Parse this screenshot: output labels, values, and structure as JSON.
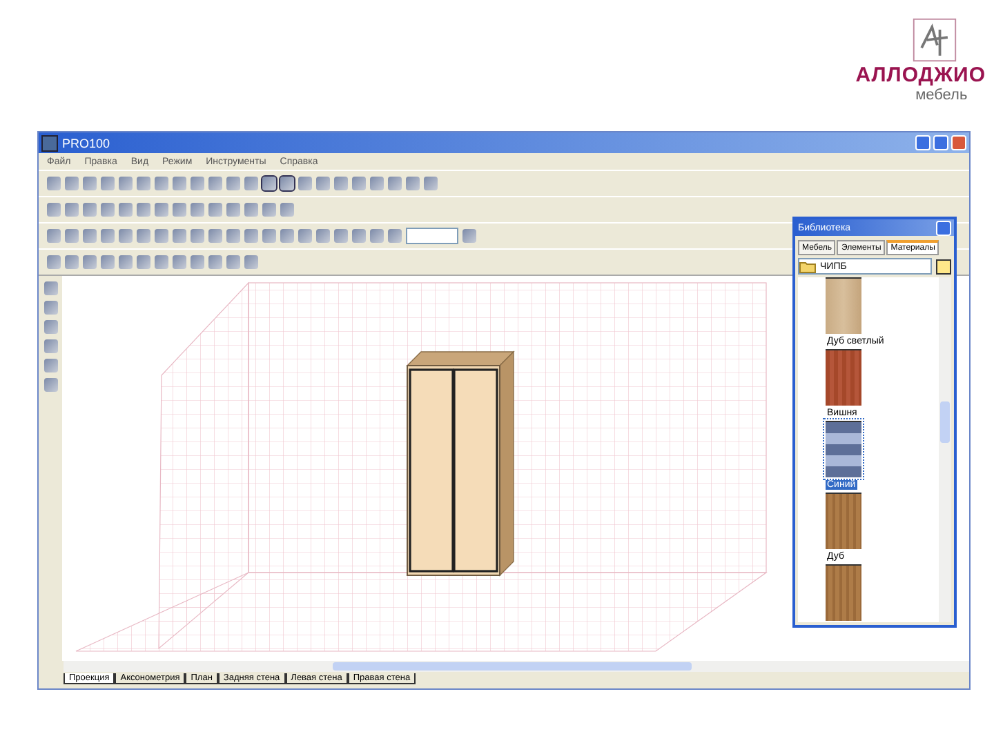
{
  "logo": {
    "name": "АЛЛОДЖИО",
    "tagline": "мебель"
  },
  "window": {
    "title": "PRO100"
  },
  "menu": [
    "Файл",
    "Правка",
    "Вид",
    "Режим",
    "Инструменты",
    "Справка"
  ],
  "library": {
    "title": "Библиотека",
    "tabs": [
      {
        "label": "Мебель",
        "selected": false
      },
      {
        "label": "Элементы",
        "selected": false
      },
      {
        "label": "Материалы",
        "selected": true
      }
    ],
    "folder": "ЧИПБ",
    "materials": [
      {
        "kind": "light-wood",
        "name": "Дуб светлый",
        "selected": false
      },
      {
        "kind": "cherry",
        "name": "Вишня",
        "selected": false
      },
      {
        "kind": "stripes",
        "name": "Синий",
        "selected": true
      },
      {
        "kind": "oak",
        "name": "Дуб",
        "selected": false
      },
      {
        "kind": "oak"
      }
    ]
  },
  "view_tabs": [
    {
      "label": "Проекция",
      "selected": true
    },
    {
      "label": "Аксонометрия",
      "selected": false
    },
    {
      "label": "План",
      "selected": false
    },
    {
      "label": "Задняя стена",
      "selected": false
    },
    {
      "label": "Левая стена",
      "selected": false
    },
    {
      "label": "Правая стена",
      "selected": false
    }
  ]
}
